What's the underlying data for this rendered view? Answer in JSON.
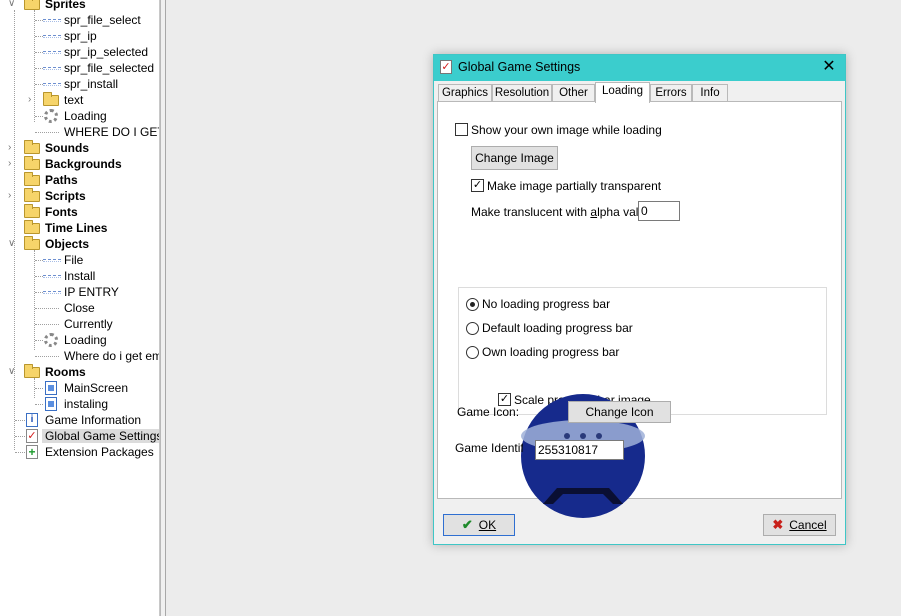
{
  "tree": {
    "items": [
      {
        "label": "Sprites"
      },
      {
        "label": "spr_file_select"
      },
      {
        "label": "spr_ip"
      },
      {
        "label": "spr_ip_selected"
      },
      {
        "label": "spr_file_selected"
      },
      {
        "label": "spr_install"
      },
      {
        "label": "text"
      },
      {
        "label": "Loading"
      },
      {
        "label": "WHERE DO I GET"
      },
      {
        "label": "Sounds"
      },
      {
        "label": "Backgrounds"
      },
      {
        "label": "Paths"
      },
      {
        "label": "Scripts"
      },
      {
        "label": "Fonts"
      },
      {
        "label": "Time Lines"
      },
      {
        "label": "Objects"
      },
      {
        "label": "File"
      },
      {
        "label": "Install"
      },
      {
        "label": "IP ENTRY"
      },
      {
        "label": "Close"
      },
      {
        "label": "Currently"
      },
      {
        "label": "Loading"
      },
      {
        "label": "Where do i get em?"
      },
      {
        "label": "Rooms"
      },
      {
        "label": "MainScreen"
      },
      {
        "label": "instaling"
      },
      {
        "label": "Game Information"
      },
      {
        "label": "Global Game Settings"
      },
      {
        "label": "Extension Packages"
      }
    ]
  },
  "dialog": {
    "title": "Global Game Settings",
    "tabs": [
      {
        "label": "Graphics"
      },
      {
        "label": "Resolution"
      },
      {
        "label": "Other"
      },
      {
        "label": "Loading"
      },
      {
        "label": "Errors"
      },
      {
        "label": "Info"
      }
    ],
    "active_tab": "Loading",
    "loading": {
      "show_own_image_label": "Show your own image while loading",
      "show_own_image_checked": false,
      "change_image_label": "Change Image",
      "partially_transparent_label": "Make image partially transparent",
      "partially_transparent_checked": true,
      "alpha_label_pre": "Make translucent with ",
      "alpha_label_key": "a",
      "alpha_label_post": "lpha value:",
      "alpha_value": "0",
      "progress_options": [
        {
          "label": "No loading progress bar",
          "selected": true
        },
        {
          "label": "Default loading progress bar",
          "selected": false
        },
        {
          "label": "Own loading progress bar",
          "selected": false
        }
      ],
      "scale_progress_label": "Scale progress bar image",
      "scale_progress_checked": true,
      "game_icon_label": "Game Icon:",
      "change_icon_label": "Change Icon",
      "game_id_label": "Game Identifier:",
      "game_id_value": "255310817"
    },
    "ok_label": "OK",
    "cancel_label": "Cancel"
  },
  "colors": {
    "titlebar": "#3bcdcd",
    "ok_check": "#1f8a2b",
    "cancel_x": "#c8201a"
  }
}
